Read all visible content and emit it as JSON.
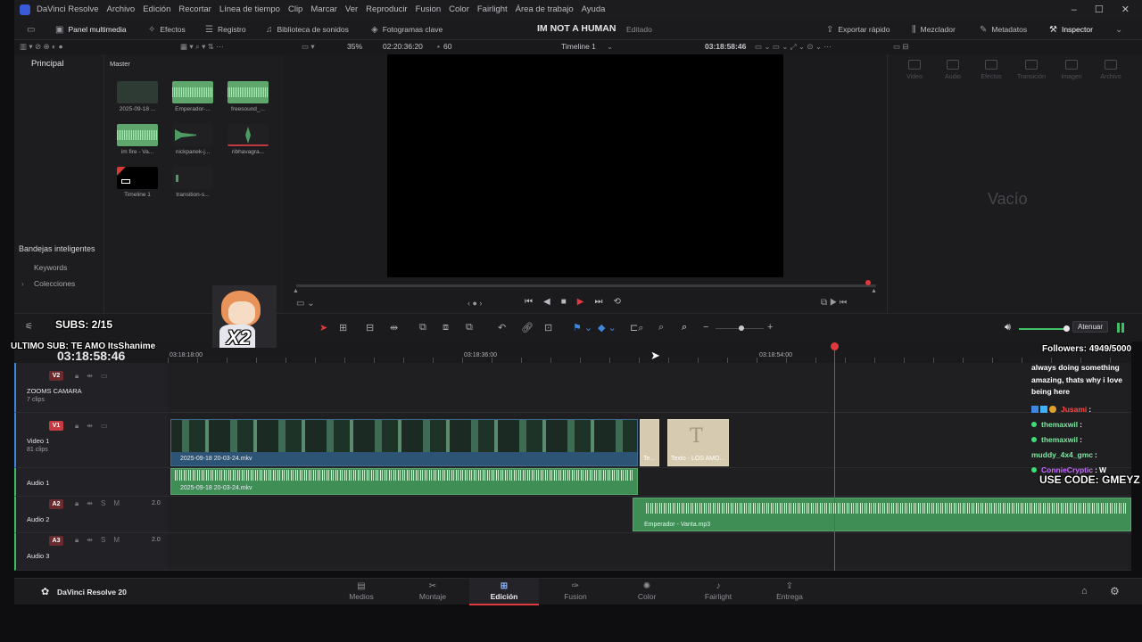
{
  "titlebar": {
    "app_name": "DaVinci Resolve",
    "menu": [
      "Archivo",
      "Edición",
      "Recortar",
      "Línea de tiempo",
      "Clip",
      "Marcar",
      "Ver",
      "Reproducir",
      "Fusion",
      "Color",
      "Fairlight",
      "Área de trabajo",
      "Ayuda"
    ]
  },
  "toolbar": {
    "media_panel": "Panel multimedia",
    "effects": "Efectos",
    "log": "Registro",
    "sound_library": "Biblioteca de sonidos",
    "keyframes": "Fotogramas clave",
    "project_title": "IM NOT A HUMAN",
    "project_status": "Editado",
    "quick_export": "Exportar rápido",
    "mixer": "Mezclador",
    "metadata": "Metadatos",
    "inspector": "Inspector"
  },
  "subbar": {
    "zoom": "35%",
    "duration": "02:20:36:20",
    "fps": "60",
    "timeline_name": "Timeline 1",
    "timecode": "03:18:58:46"
  },
  "bins": {
    "master_header": "Principal",
    "smart_bins": "Bandejas inteligentes",
    "keywords": "Keywords",
    "collections": "Colecciones"
  },
  "media": {
    "header": "Master",
    "clips": [
      {
        "name": "2025-09-18 ...",
        "kind": "video"
      },
      {
        "name": "Emperador-...",
        "kind": "audio"
      },
      {
        "name": "freesound_...",
        "kind": "audio"
      },
      {
        "name": "im fire - Va...",
        "kind": "audio"
      },
      {
        "name": "nickpanek-j...",
        "kind": "audio"
      },
      {
        "name": "ribhavagra...",
        "kind": "audio"
      },
      {
        "name": "Timeline 1",
        "kind": "timeline"
      },
      {
        "name": "transition-s...",
        "kind": "audio"
      }
    ]
  },
  "inspector": {
    "tabs": [
      "Video",
      "Audio",
      "Efectos",
      "Transición",
      "Imagen",
      "Archivo"
    ],
    "empty_label": "Vacío"
  },
  "timeline": {
    "attenuate": "Atenuar",
    "current_timecode": "03:18:58:46",
    "ruler": [
      "03:18:18:00",
      "03:18:36:00",
      "03:18:54:00"
    ],
    "tracks": {
      "v2": {
        "badge": "V2",
        "name": "ZOOMS CAMARA",
        "count": "7 clips"
      },
      "v1": {
        "badge": "V1",
        "name": "Video 1",
        "count": "81 clips"
      },
      "a1": {
        "name": "Audio 1"
      },
      "a2": {
        "badge": "A2",
        "name": "Audio 2",
        "level": "2.0"
      },
      "a3": {
        "badge": "A3",
        "name": "Audio 3",
        "level": "2.0"
      }
    },
    "clips": {
      "video_main": "2025-09-18 20-03-24.mkv",
      "video_short": "Te...",
      "text_clip": "Texto - LOS AMO...",
      "audio_main": "2025-09-18 20-03-24.mkv",
      "audio_music": "Emperador - Vanta.mp3"
    }
  },
  "pagebar": {
    "brand": "DaVinci Resolve 20",
    "pages": [
      "Medios",
      "Montaje",
      "Edición",
      "Fusion",
      "Color",
      "Fairlight",
      "Entrega"
    ],
    "active": "Edición"
  },
  "overlay": {
    "subs": "SUBS: 2/15",
    "last_sub": "ULTIMO SUB: TE AMO ItsShanime",
    "multiplier": "X2",
    "followers": "Followers: 4949/5000",
    "code": "USE CODE: GMEYZ",
    "chat_message": [
      "always doing something",
      "amazing, thats why i love",
      "being here"
    ],
    "chat": [
      {
        "user": "Jusami",
        "text": "",
        "color": "#ff4a4a"
      },
      {
        "user": "themaxwil",
        "text": "",
        "color": "#7de8a2"
      },
      {
        "user": "themaxwil",
        "text": "",
        "color": "#7de8a2"
      },
      {
        "user": "muddy_4x4_gmc",
        "text": "",
        "color": "#7de8a2"
      },
      {
        "user": "ConnieCryptic",
        "text": "W",
        "color": "#c86bff"
      }
    ]
  }
}
